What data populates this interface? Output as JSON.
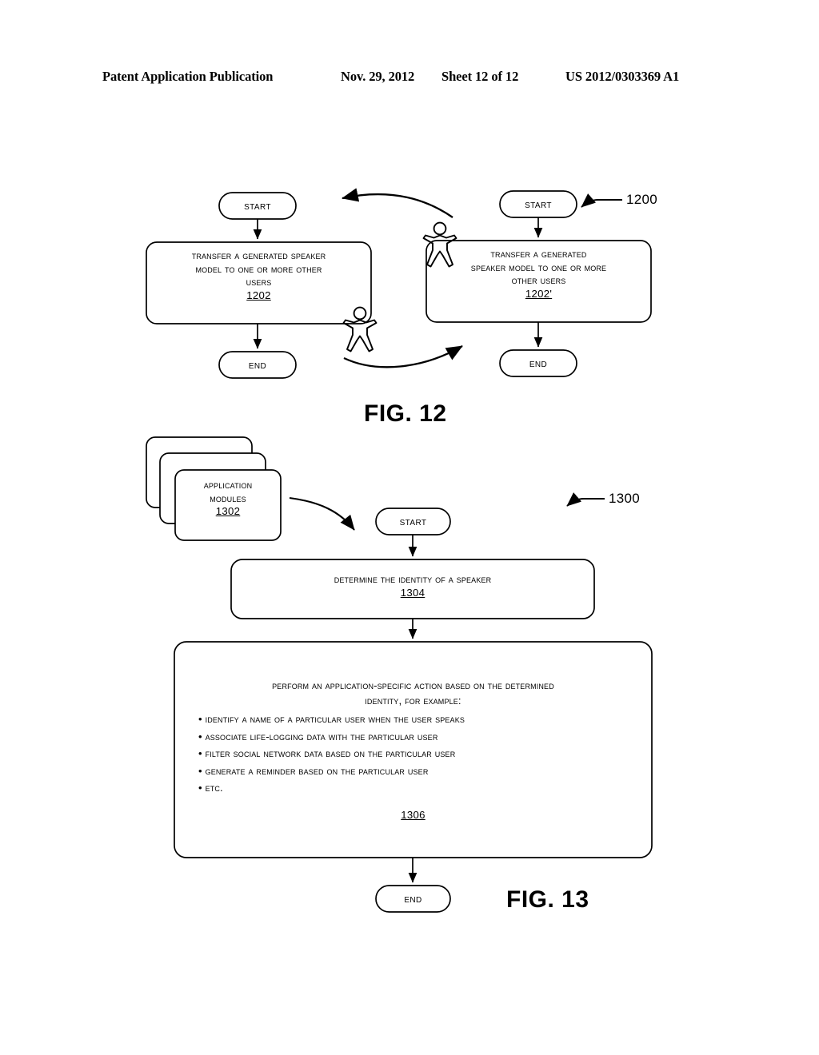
{
  "header": {
    "publication": "Patent Application Publication",
    "date": "Nov. 29, 2012",
    "sheet": "Sheet 12 of 12",
    "number": "US 2012/0303369 A1"
  },
  "figures": [
    {
      "caption": "FIG. 12",
      "ref_label": "1200",
      "flows": [
        {
          "start_label": "START",
          "process_lines": [
            "Transfer a Generated Speaker",
            "Model to One or More Other",
            "Users"
          ],
          "process_ref": "1202",
          "end_label": "END"
        },
        {
          "start_label": "START",
          "process_lines": [
            "Transfer a Generated",
            "Speaker Model to One or More",
            "Other Users"
          ],
          "process_ref": "1202'",
          "end_label": "END"
        }
      ],
      "person_icons": [
        "person-icon",
        "person-icon"
      ],
      "connectors": [
        "curved-arrow-right-to-left",
        "curved-arrow-left-to-right"
      ]
    },
    {
      "caption": "FIG. 13",
      "ref_label": "1300",
      "modules_card": {
        "lines": [
          "Application",
          "Modules"
        ],
        "ref": "1302",
        "stack_count": 3
      },
      "start_label": "START",
      "step_1304": {
        "lines": [
          "Determine the Identity of a Speaker"
        ],
        "ref": "1304"
      },
      "step_1306": {
        "head_lines": [
          "Perform an Application-Specific Action Based on the Determined",
          "Identity, for Example:"
        ],
        "bullets": [
          "Identify a Name of a Particular User When the User Speaks",
          "Associate Life-Logging Data with the Particular User",
          "Filter Social Network Data Based on the Particular User",
          "Generate a Reminder Based on the Particular User",
          "Etc."
        ],
        "ref": "1306"
      },
      "end_label": "END"
    }
  ],
  "colors": {
    "ink": "#000000",
    "paper": "#ffffff"
  }
}
